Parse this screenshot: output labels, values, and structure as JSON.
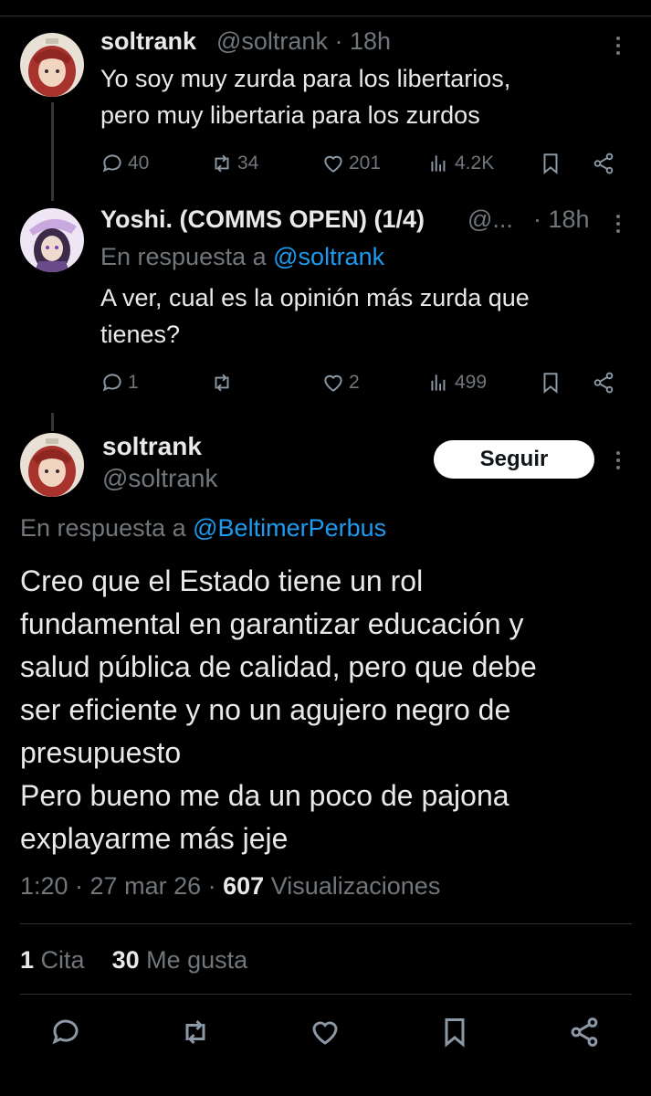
{
  "tweet1": {
    "name": "soltrank",
    "meta": "@soltrank · 18h",
    "lines": [
      "Yo soy muy zurda para los libertarios,",
      "pero muy libertaria para los zurdos"
    ],
    "replies": "40",
    "retweets": "34",
    "likes": "201",
    "views": "4.2K"
  },
  "tweet2": {
    "name": "Yoshi. (COMMS OPEN) (1/4)",
    "handle_trunc": "@...",
    "time": "· 18h",
    "reply_prefix": "En respuesta a",
    "reply_handle": "@soltrank",
    "lines": [
      "A ver, cual es la opinión más zurda que",
      "tienes?"
    ],
    "replies": "1",
    "retweets": "",
    "likes": "2",
    "views": "499"
  },
  "main": {
    "name": "soltrank",
    "handle": "@soltrank",
    "follow_label": "Seguir",
    "reply_prefix": "En respuesta a",
    "reply_handle": "@BeltimerPerbus",
    "lines": [
      "Creo que el Estado tiene un rol",
      "fundamental en garantizar educación y",
      "salud pública de calidad, pero que debe",
      "ser eficiente y no un agujero negro de",
      "presupuesto",
      "Pero bueno me da un poco de pajona",
      "explayarme más jeje"
    ],
    "time": "1:20 · 27 mar 26 ·",
    "views_count": "607",
    "views_label": "Visualizaciones",
    "quotes_count": "1",
    "quotes_label": "Cita",
    "likes_count": "30",
    "likes_label": "Me gusta"
  },
  "icons": [
    "comment-icon",
    "retweet-icon",
    "heart-icon",
    "views-icon",
    "bookmark-icon",
    "share-icon",
    "more-icon"
  ],
  "colors": {
    "background": "#000000",
    "text": "#e7e9ea",
    "muted": "#71767b",
    "link": "#1d9bf0",
    "divider": "#2f3336"
  }
}
